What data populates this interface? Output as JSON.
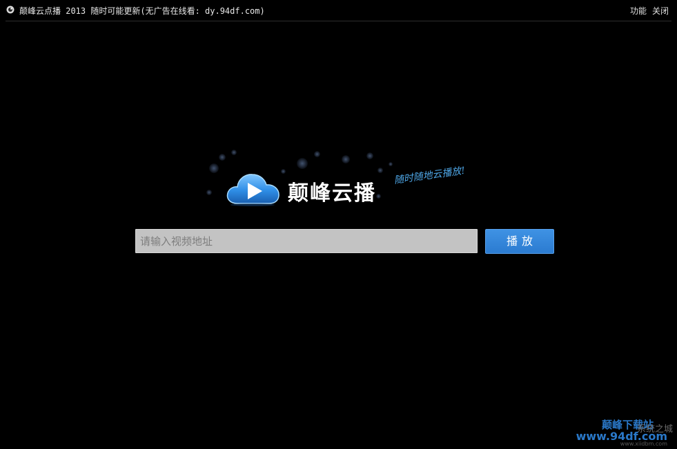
{
  "window": {
    "title": "颠峰云点播 2013 随时可能更新(无广告在线看: dy.94df.com)",
    "actions": {
      "features_label": "功能",
      "close_label": "关闭"
    }
  },
  "logo": {
    "brand_name": "颠峰云播",
    "slogan": "随时随地云播放!"
  },
  "search": {
    "placeholder": "请输入视频地址",
    "value": "",
    "play_label": "播放"
  },
  "watermark": {
    "site_name": "颠峰下载站",
    "site_url": "www.94df.com",
    "overlay_text": "系统之城",
    "tiny_text": "www.xiidbm.com"
  },
  "colors": {
    "background": "#000000",
    "accent": "#2b7bd0",
    "input_bg": "#c3c3c3"
  }
}
